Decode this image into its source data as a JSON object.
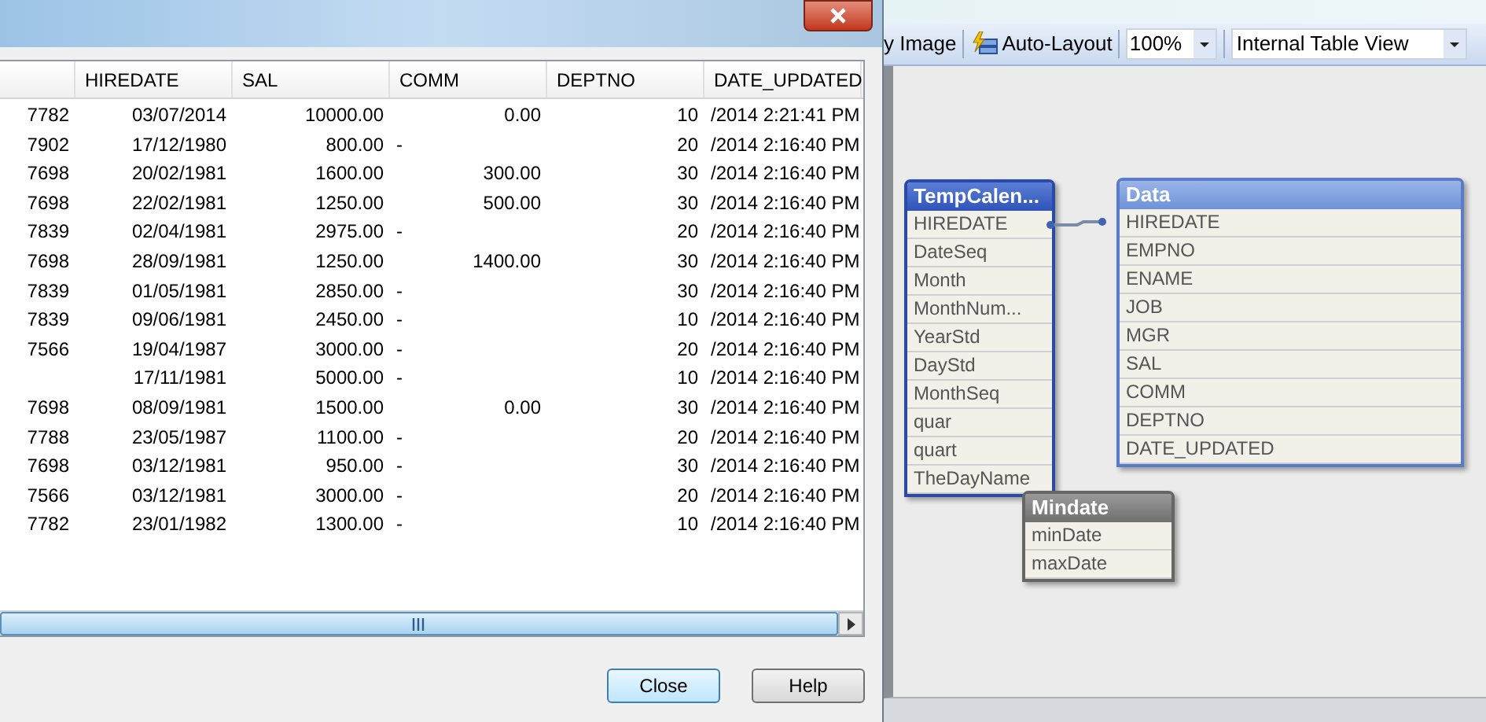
{
  "dialog": {
    "table": {
      "columns": [
        "HIREDATE",
        "SAL",
        "COMM",
        "DEPTNO",
        "DATE_UPDATED"
      ],
      "rows": [
        {
          "column_1": "7782",
          "hiredate": "03/07/2014",
          "sal": "10000.00",
          "comm": "0.00",
          "comm_null": false,
          "deptno": "10",
          "date_updated": "/2014 2:21:41 PM"
        },
        {
          "column_1": "7902",
          "hiredate": "17/12/1980",
          "sal": "800.00",
          "comm": "-",
          "comm_null": true,
          "deptno": "20",
          "date_updated": "/2014 2:16:40 PM"
        },
        {
          "column_1": "7698",
          "hiredate": "20/02/1981",
          "sal": "1600.00",
          "comm": "300.00",
          "comm_null": false,
          "deptno": "30",
          "date_updated": "/2014 2:16:40 PM"
        },
        {
          "column_1": "7698",
          "hiredate": "22/02/1981",
          "sal": "1250.00",
          "comm": "500.00",
          "comm_null": false,
          "deptno": "30",
          "date_updated": "/2014 2:16:40 PM"
        },
        {
          "column_1": "7839",
          "hiredate": "02/04/1981",
          "sal": "2975.00",
          "comm": "-",
          "comm_null": true,
          "deptno": "20",
          "date_updated": "/2014 2:16:40 PM"
        },
        {
          "column_1": "7698",
          "hiredate": "28/09/1981",
          "sal": "1250.00",
          "comm": "1400.00",
          "comm_null": false,
          "deptno": "30",
          "date_updated": "/2014 2:16:40 PM"
        },
        {
          "column_1": "7839",
          "hiredate": "01/05/1981",
          "sal": "2850.00",
          "comm": "-",
          "comm_null": true,
          "deptno": "30",
          "date_updated": "/2014 2:16:40 PM"
        },
        {
          "column_1": "7839",
          "hiredate": "09/06/1981",
          "sal": "2450.00",
          "comm": "-",
          "comm_null": true,
          "deptno": "10",
          "date_updated": "/2014 2:16:40 PM"
        },
        {
          "column_1": "7566",
          "hiredate": "19/04/1987",
          "sal": "3000.00",
          "comm": "-",
          "comm_null": true,
          "deptno": "20",
          "date_updated": "/2014 2:16:40 PM"
        },
        {
          "hiredate": "17/11/1981",
          "sal": "5000.00",
          "comm": "-",
          "comm_null": true,
          "deptno": "10",
          "date_updated": "/2014 2:16:40 PM"
        },
        {
          "column_1": "7698",
          "hiredate": "08/09/1981",
          "sal": "1500.00",
          "comm": "0.00",
          "comm_null": false,
          "deptno": "30",
          "date_updated": "/2014 2:16:40 PM"
        },
        {
          "column_1": "7788",
          "hiredate": "23/05/1987",
          "sal": "1100.00",
          "comm": "-",
          "comm_null": true,
          "deptno": "20",
          "date_updated": "/2014 2:16:40 PM"
        },
        {
          "column_1": "7698",
          "hiredate": "03/12/1981",
          "sal": "950.00",
          "comm": "-",
          "comm_null": true,
          "deptno": "30",
          "date_updated": "/2014 2:16:40 PM"
        },
        {
          "column_1": "7566",
          "hiredate": "03/12/1981",
          "sal": "3000.00",
          "comm": "-",
          "comm_null": true,
          "deptno": "20",
          "date_updated": "/2014 2:16:40 PM"
        },
        {
          "column_1": "7782",
          "hiredate": "23/01/1982",
          "sal": "1300.00",
          "comm": "-",
          "comm_null": true,
          "deptno": "10",
          "date_updated": "/2014 2:16:40 PM"
        }
      ]
    },
    "buttons": [
      "Close",
      "Help"
    ]
  },
  "toolbar": {
    "copy_image_label": "y Image",
    "auto_layout_label": "Auto-Layout",
    "zoom": "100%",
    "view": "Internal Table View"
  },
  "canvas": {
    "tables": [
      {
        "name": "TempCalen...",
        "kind": "linked",
        "fields": [
          "HIREDATE",
          "DateSeq",
          "Month",
          "MonthNum...",
          "YearStd",
          "DayStd",
          "MonthSeq",
          "quar",
          "quart",
          "TheDayName"
        ]
      },
      {
        "name": "Data",
        "kind": "selected",
        "fields": [
          "HIREDATE",
          "EMPNO",
          "ENAME",
          "JOB",
          "MGR",
          "SAL",
          "COMM",
          "DEPTNO",
          "DATE_UPDATED"
        ]
      },
      {
        "name": "Mindate",
        "kind": "unlinked",
        "fields": [
          "minDate",
          "maxDate"
        ]
      }
    ]
  }
}
